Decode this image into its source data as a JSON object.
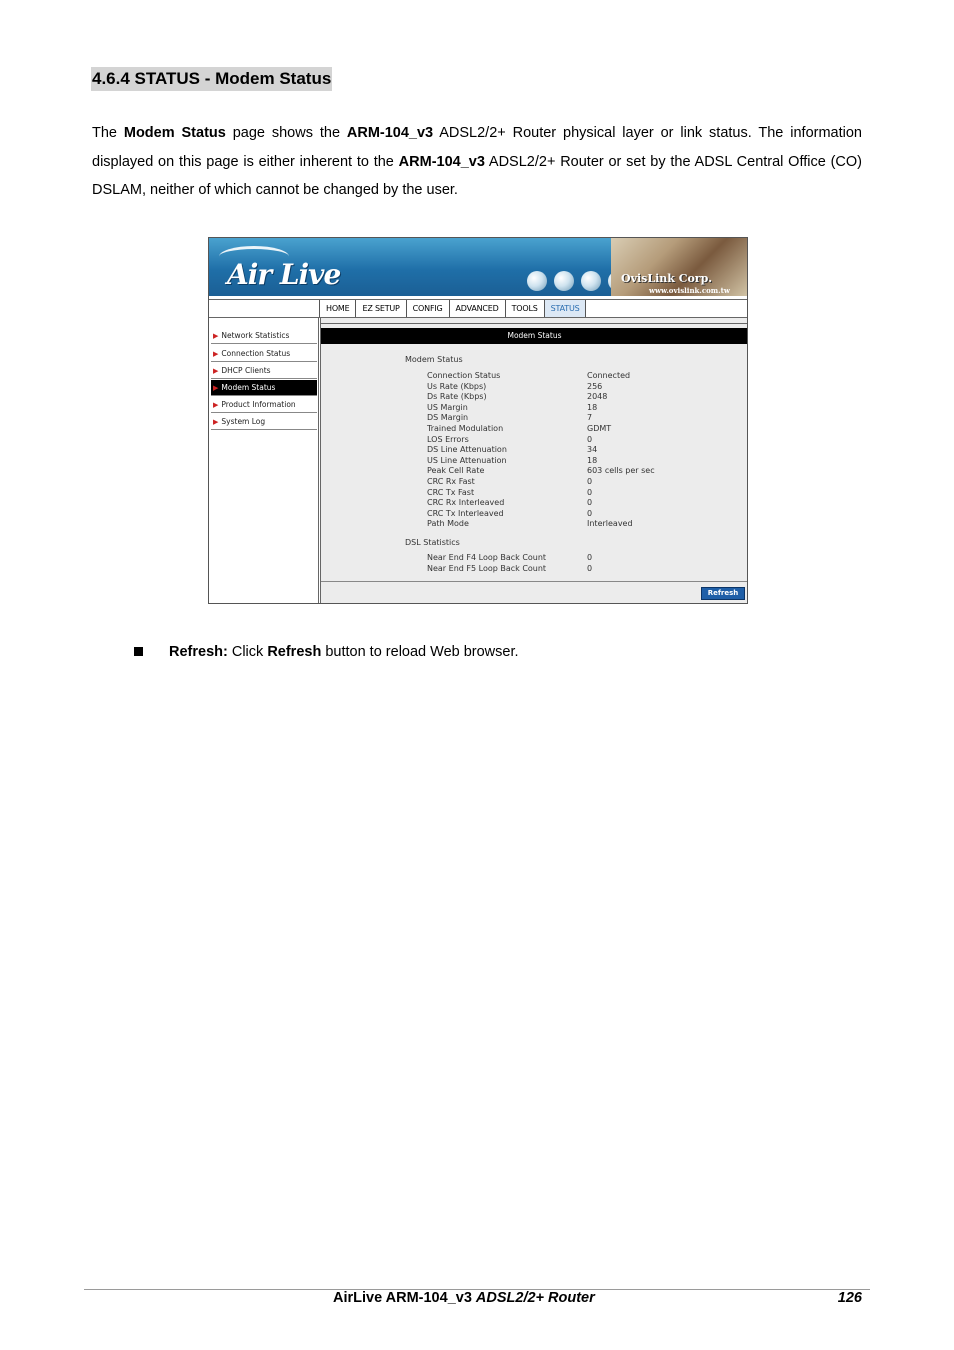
{
  "heading": "4.6.4 STATUS - Modem Status",
  "intro": {
    "p1": "The ",
    "b1": "Modem Status",
    "p2": " page shows the ",
    "b2": "ARM-104_v3",
    "p3": " ADSL2/2+ Router physical layer or link status. The information displayed on this page is either inherent to the ",
    "b3": "ARM-104_v3",
    "p4": " ADSL2/2+ Router or set by the ADSL Central Office (CO) DSLAM, neither of which cannot be changed by the user."
  },
  "screenshot": {
    "logo": "Air Live",
    "brand": "OvisLink Corp.",
    "brand_url": "www.ovislink.com.tw",
    "tabs": [
      "HOME",
      "EZ SETUP",
      "CONFIG",
      "ADVANCED",
      "TOOLS",
      "STATUS"
    ],
    "sidebar": [
      "Network Statistics",
      "Connection Status",
      "DHCP Clients",
      "Modem Status",
      "Product Information",
      "System Log"
    ],
    "title": "Modem Status",
    "section1": "Modem Status",
    "modem_rows": [
      {
        "k": "Connection Status",
        "v": "Connected"
      },
      {
        "k": "Us Rate (Kbps)",
        "v": "256"
      },
      {
        "k": "Ds Rate (Kbps)",
        "v": "2048"
      },
      {
        "k": "US Margin",
        "v": "18"
      },
      {
        "k": "DS Margin",
        "v": "7"
      },
      {
        "k": "Trained Modulation",
        "v": "GDMT"
      },
      {
        "k": "LOS Errors",
        "v": "0"
      },
      {
        "k": "DS Line Attenuation",
        "v": "34"
      },
      {
        "k": "US Line Attenuation",
        "v": "18"
      },
      {
        "k": "Peak Cell Rate",
        "v": "603 cells per sec"
      },
      {
        "k": "CRC Rx Fast",
        "v": "0"
      },
      {
        "k": "CRC Tx Fast",
        "v": "0"
      },
      {
        "k": "CRC Rx Interleaved",
        "v": "0"
      },
      {
        "k": "CRC Tx Interleaved",
        "v": "0"
      },
      {
        "k": "Path Mode",
        "v": "Interleaved"
      }
    ],
    "section2": "DSL Statistics",
    "dsl_rows": [
      {
        "k": "Near End F4 Loop Back Count",
        "v": "0"
      },
      {
        "k": "Near End F5 Loop Back Count",
        "v": "0"
      }
    ],
    "refresh_label": "Refresh"
  },
  "bullet": {
    "label": "Refresh:",
    "t1": " Click ",
    "b": "Refresh",
    "t2": " button to reload Web browser."
  },
  "footer": {
    "product": "AirLive ARM-104_v3 ",
    "product_italic": "ADSL2/2+ Router",
    "page": "126"
  }
}
